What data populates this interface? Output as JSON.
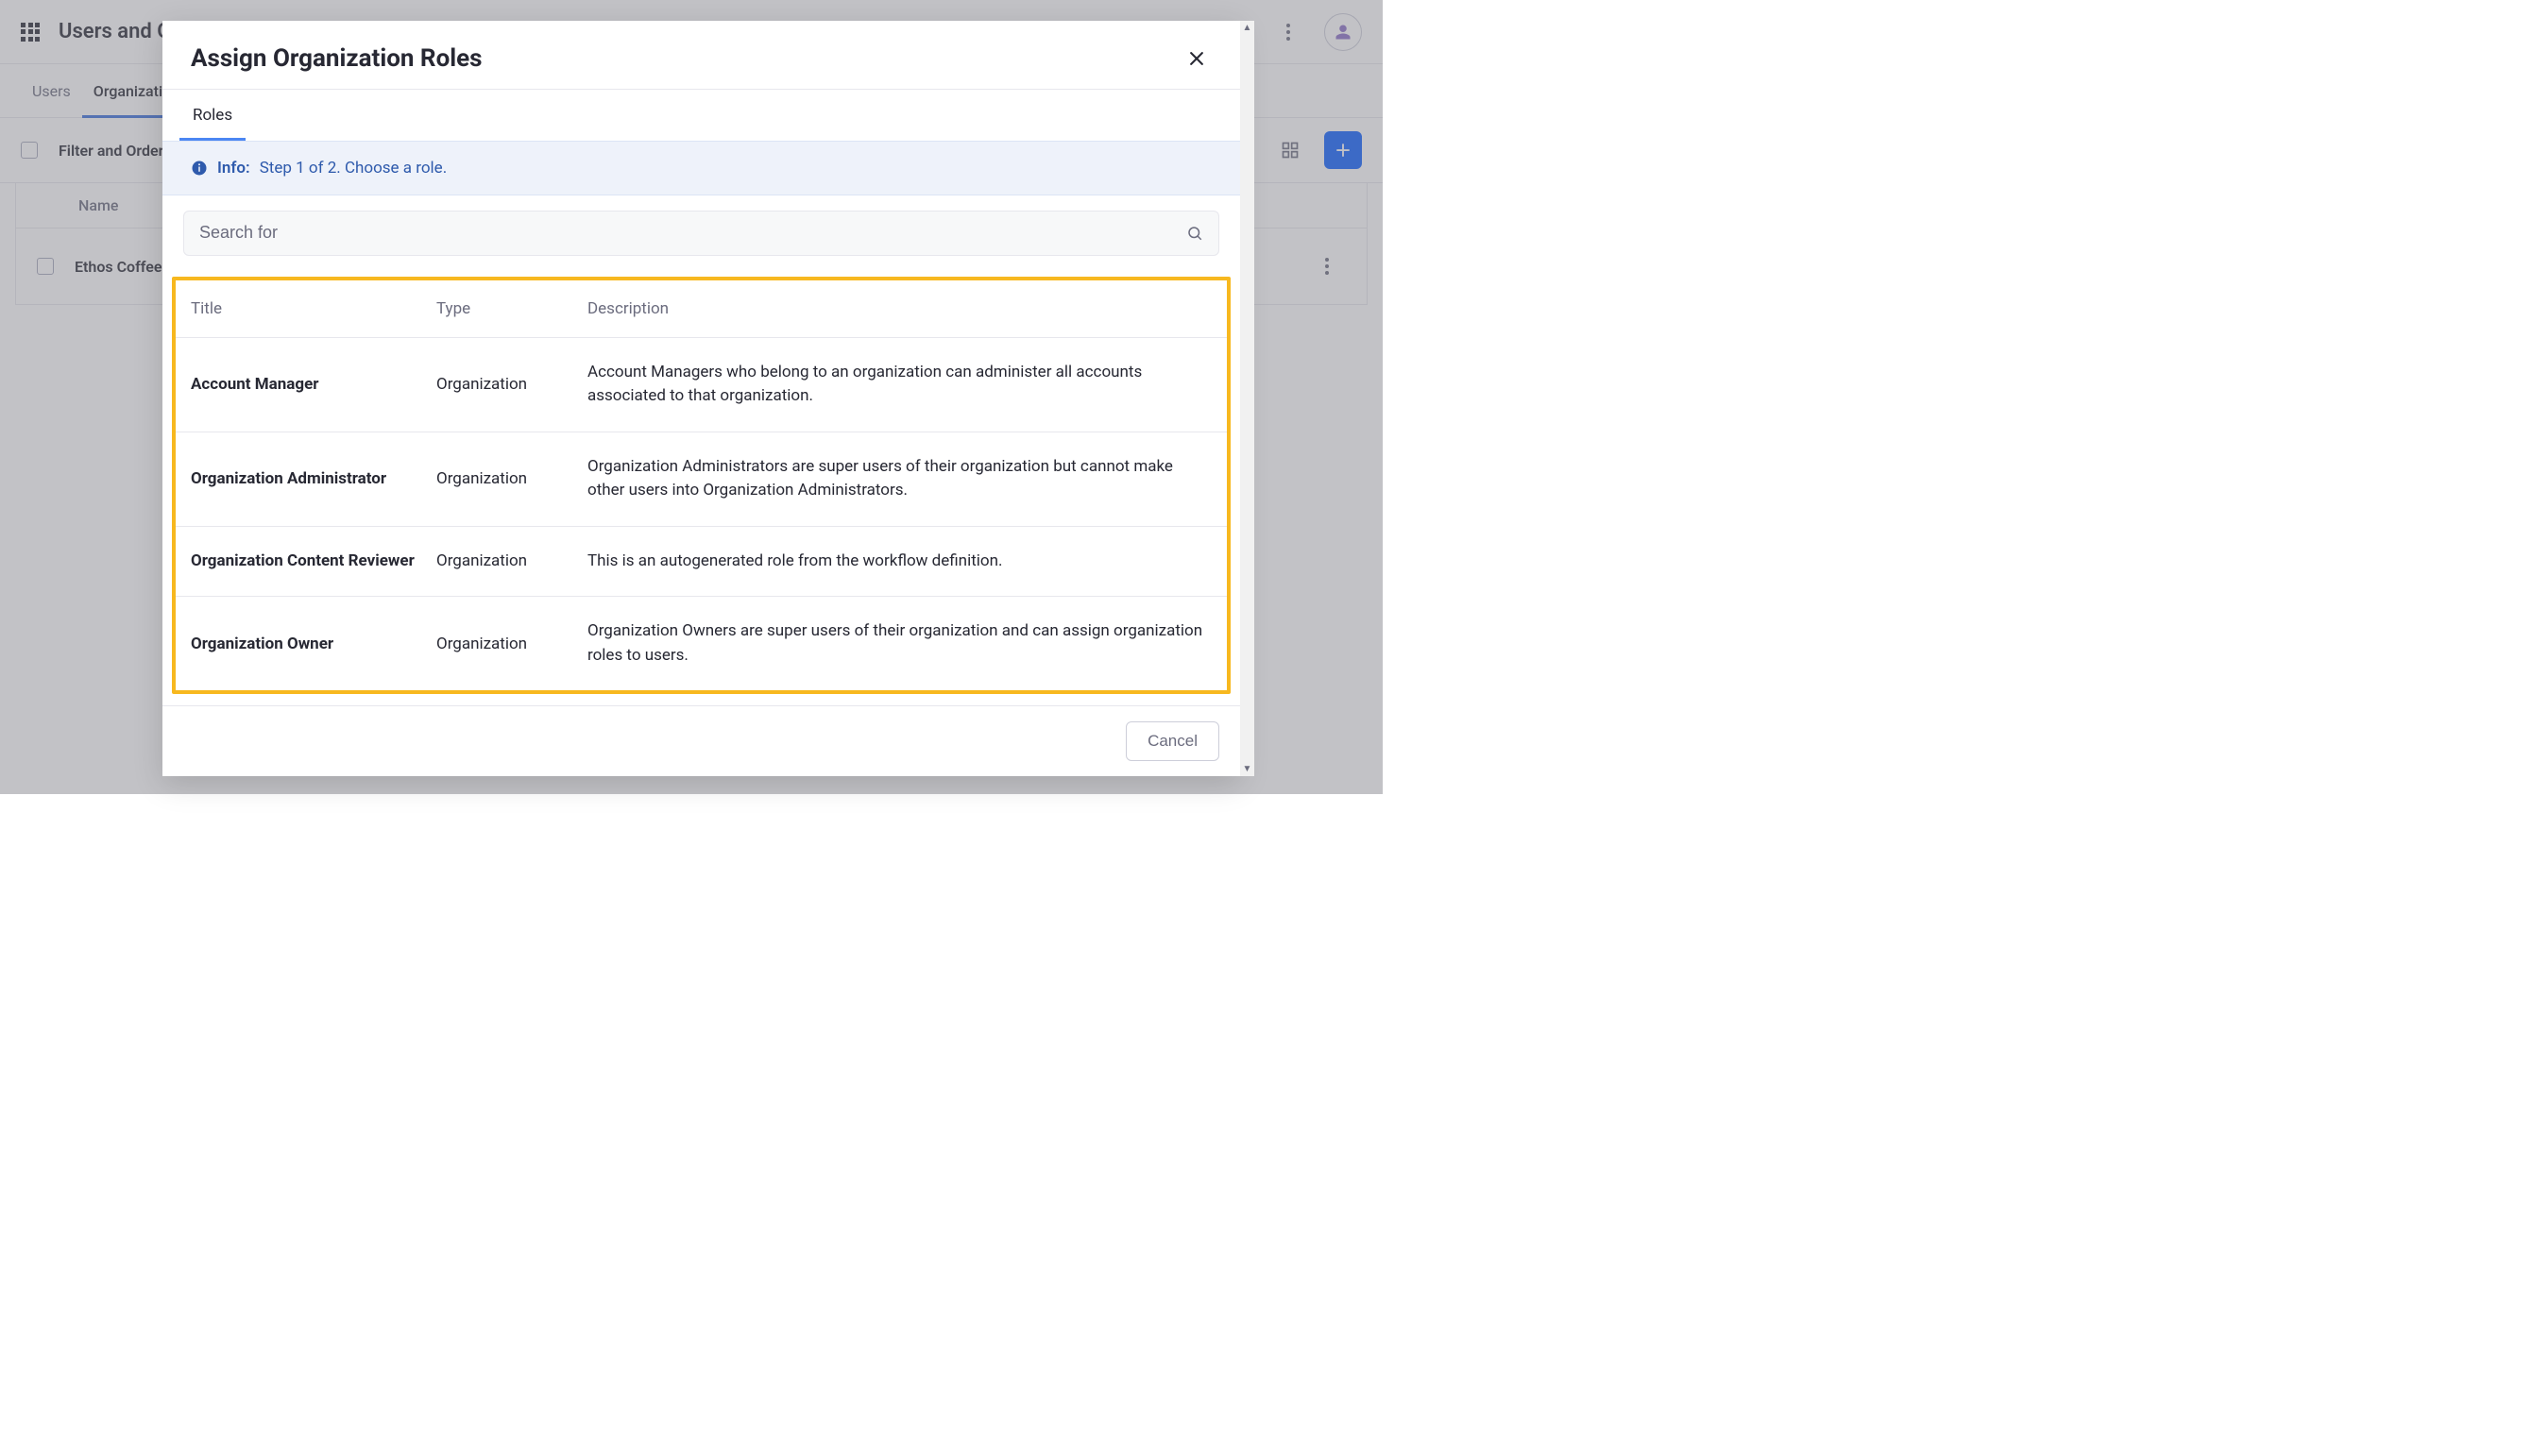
{
  "header": {
    "page_title": "Users and Organizations"
  },
  "tabs": {
    "users": "Users",
    "organizations": "Organizations"
  },
  "toolbar": {
    "filter_label": "Filter and Order"
  },
  "list": {
    "header_name": "Name",
    "row_name": "Ethos Coffee"
  },
  "modal": {
    "title": "Assign Organization Roles",
    "tab_roles": "Roles",
    "info_label": "Info:",
    "info_text": "Step 1 of 2. Choose a role.",
    "search_placeholder": "Search for",
    "cancel_label": "Cancel",
    "thead": {
      "title": "Title",
      "type": "Type",
      "description": "Description"
    },
    "roles": [
      {
        "title": "Account Manager",
        "type": "Organization",
        "description": "Account Managers who belong to an organization can administer all accounts associated to that organization."
      },
      {
        "title": "Organization Administrator",
        "type": "Organization",
        "description": "Organization Administrators are super users of their organization but cannot make other users into Organization Administrators."
      },
      {
        "title": "Organization Content Reviewer",
        "type": "Organization",
        "description": "This is an autogenerated role from the workflow definition."
      },
      {
        "title": "Organization Owner",
        "type": "Organization",
        "description": "Organization Owners are super users of their organization and can assign organization roles to users."
      }
    ]
  }
}
